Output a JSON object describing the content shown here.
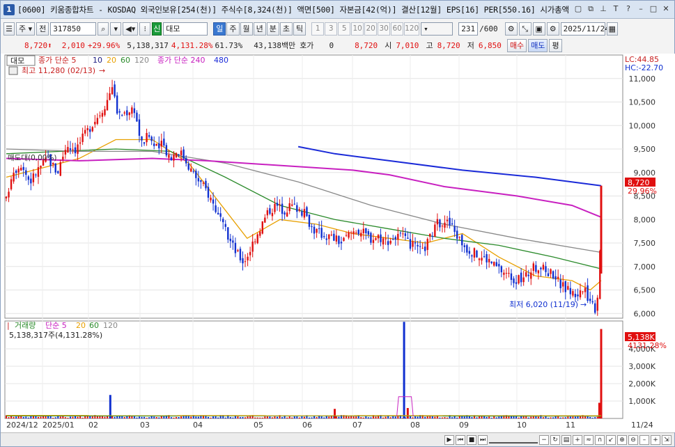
{
  "window": {
    "badge": "1",
    "title": "[0600] 키움종합차트 - KOSDAQ 외국인보유[254(천)] 주식수[8,324(천)] 액면[500] 자본금[42(억)] 결산[12월] EPS[16] PER[550.16] 시가총액"
  },
  "toolbar": {
    "period_sel": "주",
    "prev": "전",
    "code": "317850",
    "stock_tag": "신",
    "stock_name": "대모",
    "periods": [
      "일",
      "주",
      "월",
      "년",
      "분",
      "초",
      "틱"
    ],
    "active_period": "일",
    "intervals": [
      "1",
      "3",
      "5",
      "10",
      "20",
      "30",
      "60",
      "120"
    ],
    "count": "231",
    "count_total": "/600",
    "date": "2025/11/24"
  },
  "quote": {
    "price": "8,720",
    "change": "2,010",
    "change_pct": "+29.96%",
    "volume": "5,138,317",
    "vol_ratio": "4,131.28%",
    "turnover": "61.73%",
    "amount": "43,138백만",
    "hoga_label": "호가",
    "hoga": "0",
    "hoga_price": "8,720",
    "open_label": "시",
    "open": "7,010",
    "high_label": "고",
    "high": "8,720",
    "low_label": "저",
    "low": "6,850",
    "buy": "매수",
    "sell": "매도",
    "eval": "평"
  },
  "price_panel": {
    "name_tag": "대모",
    "legend_ma": "종가 단순 5",
    "ma_periods": [
      "10",
      "20",
      "60",
      "120"
    ],
    "legend_ma2": "종가 단순 240",
    "ma2_extra": "480",
    "high_note": "최고 11,280 (02/13)",
    "low_note": "최저 6,020 (11/19)",
    "left_note": "매도대(0,00%)",
    "lc": "LC:44.85",
    "hc": "HC:-22.70",
    "last_price_tag": "8,720",
    "last_pct_tag": "29.96%"
  },
  "volume_panel": {
    "legend": "거래량",
    "ma_label": "단순 5",
    "ma_periods": [
      "20",
      "60",
      "120"
    ],
    "value": "5,138,317주(4,131.28%)",
    "last_tag": "5,138K",
    "last_pct": "4131.28%"
  },
  "colors": {
    "up": "#e01010",
    "down": "#1030d0",
    "ma5": "#1a1a80",
    "ma10": "#1a1a80",
    "ma20": "#e8a000",
    "ma60": "#2a8a2a",
    "ma120": "#888888",
    "ma240": "#c820c0",
    "ma480": "#1a2ad8"
  },
  "chart_data": {
    "type": "candlestick",
    "title": "대모 (317850) daily",
    "y_ticks": [
      "11,000",
      "10,500",
      "10,000",
      "9,500",
      "9,000",
      "8,500",
      "8,000",
      "7,500",
      "7,000",
      "6,500",
      "6,000"
    ],
    "y_range": [
      5900,
      11500
    ],
    "x_ticks": [
      "2024/12",
      "2025/01",
      "02",
      "03",
      "04",
      "05",
      "06",
      "07",
      "08",
      "09",
      "10",
      "11",
      "11/24"
    ],
    "vol_ticks": [
      "4,000K",
      "3,000K",
      "2,000K",
      "1,000K"
    ],
    "vol_range": [
      0,
      5600000
    ],
    "price_path": [
      [
        0,
        8400
      ],
      [
        3,
        9000
      ],
      [
        8,
        9200
      ],
      [
        13,
        8800
      ],
      [
        18,
        9100
      ],
      [
        23,
        9300
      ],
      [
        28,
        9000
      ],
      [
        33,
        9600
      ],
      [
        38,
        9500
      ],
      [
        43,
        9800
      ],
      [
        48,
        10100
      ],
      [
        52,
        10300
      ],
      [
        56,
        10600
      ],
      [
        58,
        10900
      ],
      [
        60,
        10400
      ],
      [
        62,
        10200
      ],
      [
        66,
        10300
      ],
      [
        70,
        10400
      ],
      [
        74,
        9600
      ],
      [
        78,
        9800
      ],
      [
        82,
        9500
      ],
      [
        86,
        9600
      ],
      [
        90,
        9300
      ],
      [
        94,
        9500
      ],
      [
        98,
        9300
      ],
      [
        102,
        9000
      ],
      [
        106,
        8800
      ],
      [
        110,
        8600
      ],
      [
        114,
        8300
      ],
      [
        118,
        7900
      ],
      [
        122,
        7600
      ],
      [
        126,
        7300
      ],
      [
        130,
        7100
      ],
      [
        133,
        7300
      ],
      [
        136,
        7600
      ],
      [
        140,
        7900
      ],
      [
        144,
        8200
      ],
      [
        148,
        8300
      ],
      [
        152,
        8200
      ],
      [
        156,
        8300
      ],
      [
        160,
        8250
      ],
      [
        164,
        8100
      ],
      [
        168,
        7800
      ],
      [
        172,
        7700
      ],
      [
        176,
        7650
      ],
      [
        180,
        7600
      ],
      [
        184,
        7500
      ],
      [
        188,
        7700
      ],
      [
        192,
        7800
      ],
      [
        196,
        7700
      ],
      [
        200,
        7600
      ],
      [
        204,
        7650
      ],
      [
        208,
        7550
      ],
      [
        212,
        7600
      ],
      [
        216,
        7650
      ],
      [
        220,
        7500
      ],
      [
        224,
        7400
      ],
      [
        228,
        7300
      ],
      [
        232,
        7600
      ],
      [
        236,
        7900
      ],
      [
        240,
        8000
      ],
      [
        244,
        7850
      ],
      [
        248,
        7600
      ],
      [
        252,
        7400
      ],
      [
        256,
        7300
      ],
      [
        260,
        7200
      ],
      [
        264,
        7150
      ],
      [
        268,
        7000
      ],
      [
        272,
        6900
      ],
      [
        276,
        6800
      ],
      [
        280,
        6700
      ],
      [
        284,
        6750
      ],
      [
        288,
        6950
      ],
      [
        292,
        7000
      ],
      [
        296,
        6900
      ],
      [
        300,
        6850
      ],
      [
        304,
        6600
      ],
      [
        308,
        6500
      ],
      [
        312,
        6400
      ],
      [
        316,
        6500
      ],
      [
        320,
        6300
      ],
      [
        323,
        6100
      ],
      [
        325,
        6700
      ],
      [
        326,
        8720
      ]
    ],
    "ma_lines": [
      {
        "name": "20",
        "color": "#e8a000",
        "points": [
          [
            0,
            8900
          ],
          [
            20,
            9100
          ],
          [
            40,
            9300
          ],
          [
            60,
            9700
          ],
          [
            80,
            9700
          ],
          [
            100,
            9200
          ],
          [
            120,
            8200
          ],
          [
            132,
            7600
          ],
          [
            150,
            8000
          ],
          [
            170,
            7900
          ],
          [
            190,
            7700
          ],
          [
            210,
            7600
          ],
          [
            230,
            7500
          ],
          [
            250,
            7700
          ],
          [
            270,
            7200
          ],
          [
            290,
            6800
          ],
          [
            310,
            6700
          ],
          [
            320,
            6500
          ],
          [
            326,
            6700
          ]
        ]
      },
      {
        "name": "60",
        "color": "#2a8a2a",
        "points": [
          [
            0,
            9400
          ],
          [
            30,
            9450
          ],
          [
            60,
            9500
          ],
          [
            90,
            9450
          ],
          [
            120,
            8900
          ],
          [
            150,
            8300
          ],
          [
            180,
            8000
          ],
          [
            210,
            7800
          ],
          [
            240,
            7600
          ],
          [
            270,
            7450
          ],
          [
            300,
            7200
          ],
          [
            326,
            6950
          ]
        ]
      },
      {
        "name": "120",
        "color": "#888888",
        "points": [
          [
            0,
            9500
          ],
          [
            40,
            9450
          ],
          [
            80,
            9450
          ],
          [
            120,
            9200
          ],
          [
            160,
            8800
          ],
          [
            200,
            8300
          ],
          [
            240,
            7900
          ],
          [
            280,
            7600
          ],
          [
            326,
            7300
          ]
        ]
      },
      {
        "name": "240",
        "color": "#c820c0",
        "points": [
          [
            0,
            9300
          ],
          [
            40,
            9250
          ],
          [
            80,
            9300
          ],
          [
            110,
            9250
          ],
          [
            150,
            9150
          ],
          [
            190,
            9050
          ],
          [
            210,
            8950
          ],
          [
            240,
            8700
          ],
          [
            280,
            8500
          ],
          [
            310,
            8300
          ],
          [
            326,
            8050
          ]
        ]
      },
      {
        "name": "480",
        "color": "#1a2ad8",
        "points": [
          [
            160,
            9550
          ],
          [
            180,
            9400
          ],
          [
            210,
            9250
          ],
          [
            250,
            9050
          ],
          [
            290,
            8900
          ],
          [
            326,
            8720
          ]
        ]
      }
    ],
    "volume_spikes": [
      [
        57,
        1350000
      ],
      [
        180,
        550000
      ],
      [
        218,
        5550000
      ],
      [
        220,
        600000
      ],
      [
        325,
        900000
      ],
      [
        326,
        5138317
      ]
    ]
  }
}
